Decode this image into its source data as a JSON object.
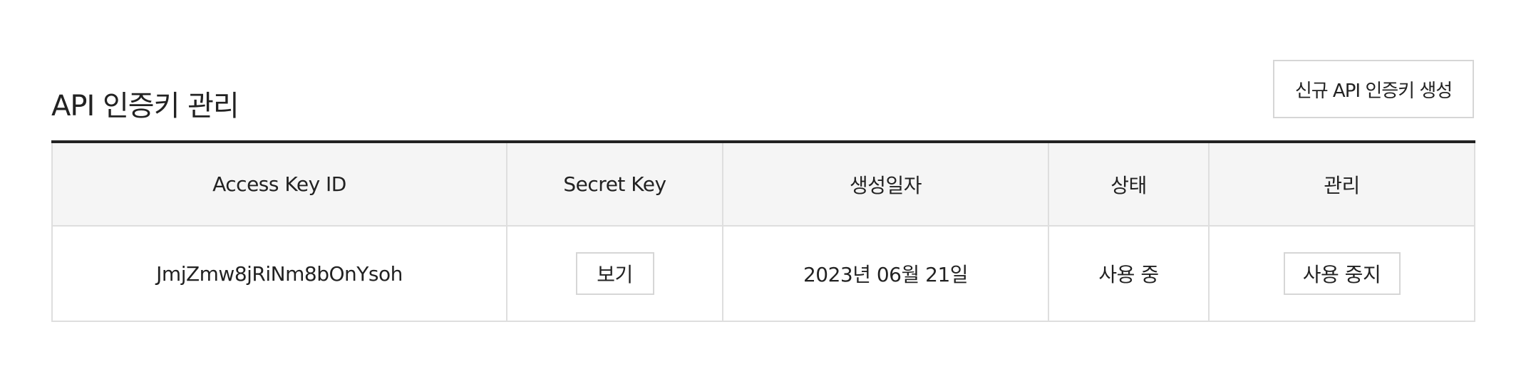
{
  "page": {
    "title": "API 인증키 관리",
    "create_button": "신규 API 인증키 생성"
  },
  "table": {
    "headers": [
      "Access Key ID",
      "Secret Key",
      "생성일자",
      "상태",
      "관리"
    ],
    "rows": [
      {
        "access_key_id": "JmjZmw8jRiNm8bOnYsoh",
        "secret_key_button": "보기",
        "created_date": "2023년 06월 21일",
        "status": "사용 중",
        "manage_button": "사용 중지"
      }
    ]
  },
  "colors": {
    "text": "#222222",
    "header_bg": "#f5f5f5",
    "border": "#dedede",
    "table_top_border": "#222222"
  }
}
